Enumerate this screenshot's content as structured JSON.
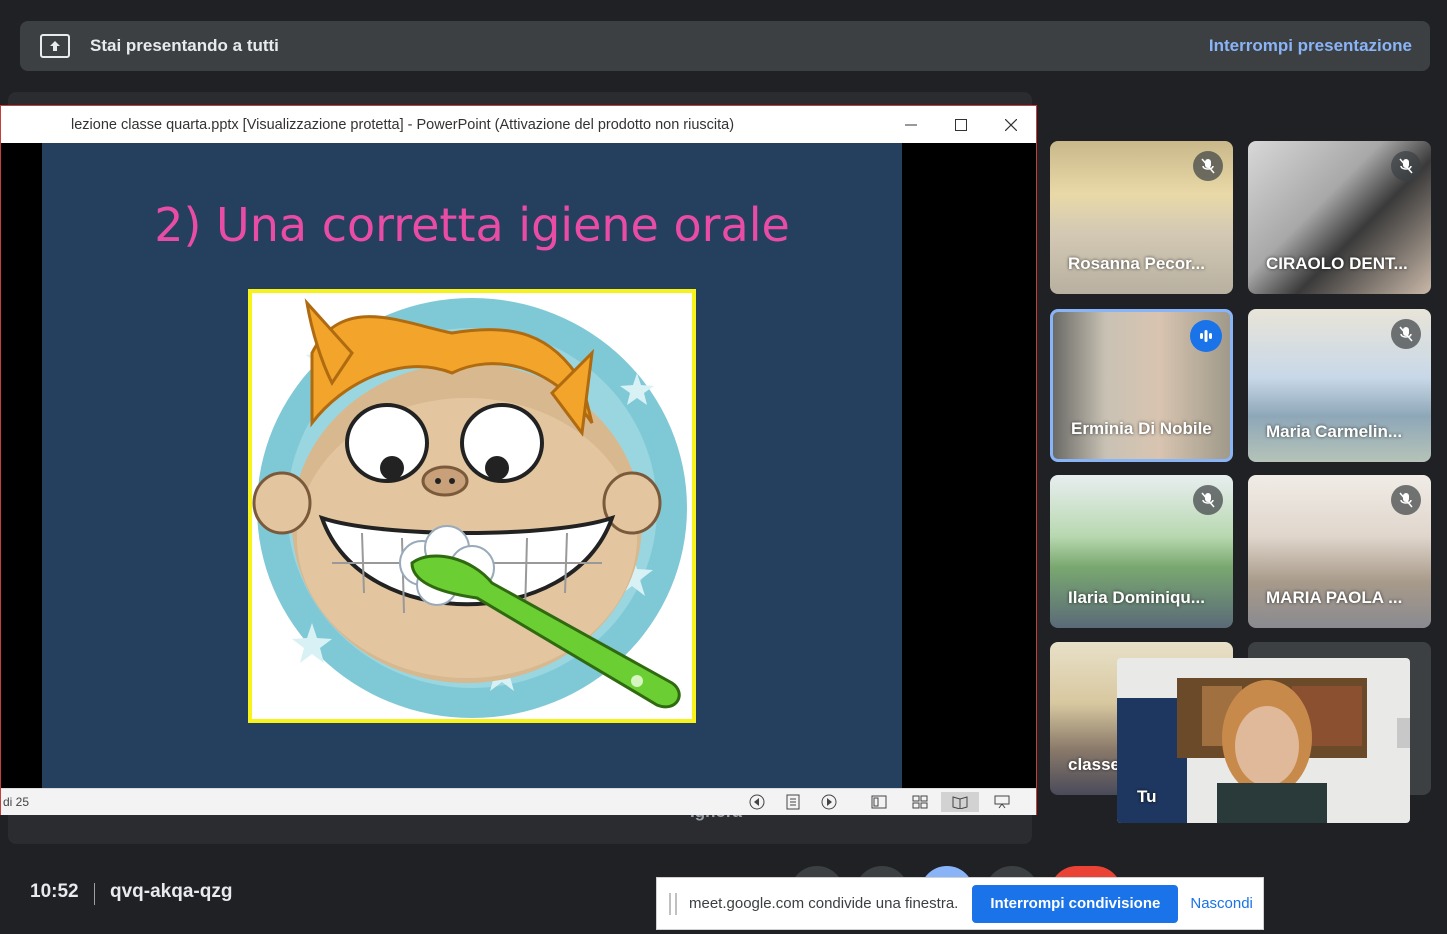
{
  "banner": {
    "title": "Stai presentando a tutti",
    "stop_label": "Interrompi presentazione"
  },
  "stage_caption": "Ignora",
  "ppt": {
    "window_title": "lezione classe quarta.pptx [Visualizzazione protetta] - PowerPoint (Attivazione del prodotto non riuscita)",
    "slide_title": "2) Una corretta igiene orale",
    "slide_counter": "di 25"
  },
  "participants": [
    {
      "name": "Rosanna Pecor...",
      "muted": true
    },
    {
      "name": "CIRAOLO DENT...",
      "muted": true
    },
    {
      "name": "Erminia Di Nobile",
      "muted": false,
      "speaking": true
    },
    {
      "name": "Maria Carmelin...",
      "muted": true
    },
    {
      "name": "Ilaria Dominiqu...",
      "muted": true
    },
    {
      "name": "MARIA PAOLA ...",
      "muted": true
    },
    {
      "name": "classe",
      "muted": false
    }
  ],
  "self_tile": {
    "name": "Tu"
  },
  "meeting": {
    "time": "10:52",
    "code": "qvq-akqa-qzg"
  },
  "share_bar": {
    "message": "meet.google.com condivide una finestra.",
    "stop_label": "Interrompi condivisione",
    "hide_label": "Nascondi"
  },
  "colors": {
    "meet_bg": "#202124",
    "accent_blue": "#8ab4f8",
    "button_blue": "#1a73e8",
    "slide_bg": "#24405e",
    "slide_title": "#e94ca4",
    "stop_red": "#ea4335"
  }
}
